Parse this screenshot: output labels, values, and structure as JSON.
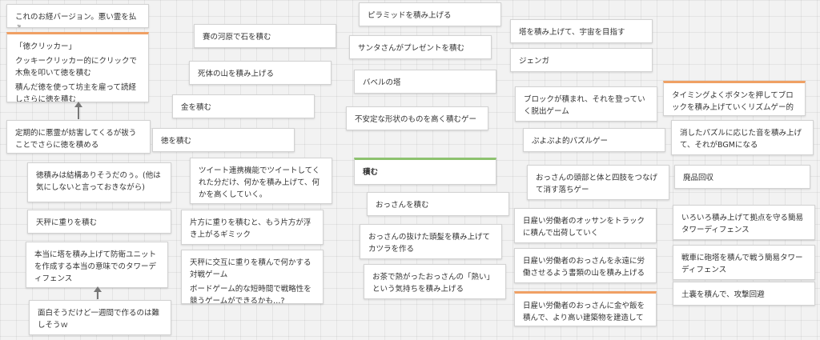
{
  "cards": {
    "c1": "これのお経バージョン。悪い霊を払う。",
    "c2_title": "「徳クリッカー」",
    "c2_line1": "クッキークリッカー的にクリックで木魚を叩いて徳を積む",
    "c2_line2": "積んだ徳を使って坊主を雇って読経しさらに徳を積む",
    "c3": "定期的に悪霊が妨害してくるが祓うことでさらに徳を積める",
    "c4": "徳積みは結構ありそうだのぅ。(他は気にしないと言っておきながら)",
    "c5": "天秤に重りを積む",
    "c6": "本当に塔を積み上げて防衛ユニットを作成する本当の意味でのタワーディフェンス",
    "c7": "面白そうだけど一週間で作るのは難しそうｗ",
    "c8": "賽の河原で石を積む",
    "c9": "死体の山を積み上げる",
    "c10": "金を積む",
    "c11": "徳を積む",
    "c12": "ツイート連携機能でツイートしてくれた分だけ、何かを積み上げて、何かを高くしていく。",
    "c13": "片方に重りを積むと、もう片方が浮き上がるギミック",
    "c14_line1": "天秤に交互に重りを積んで何かする対戦ゲーム",
    "c14_line2": "ボードゲーム的な短時間で戦略性を競うゲームができるかも…?",
    "c15": "ピラミッドを積み上げる",
    "c16": "サンタさんがプレゼントを積む",
    "c17": "バベルの塔",
    "c18": "不安定な形状のものを高く積むゲー",
    "c19": "積む",
    "c20": "おっさんを積む",
    "c21": "おっさんの抜けた頭髪を積み上げてカツラを作る",
    "c22": "お茶で熱がったおっさんの「熱い」という気持ちを積み上げる",
    "c23": "塔を積み上げて、宇宙を目指す",
    "c24": "ジェンガ",
    "c25": "ブロックが積まれ、それを登っていく脱出ゲーム",
    "c26": "ぷよぷよ的パズルゲー",
    "c27": "おっさんの頭部と体と四肢をつなげて消す落ちゲー",
    "c28": "日雇い労働者のオッサンをトラックに積んで出荷していく",
    "c29": "日雇い労働者のおっさんを永遠に労働させるよう書類の山を積み上げる",
    "c30": "日雇い労働者のおっさんに金や飯を積んで、より高い建築物を建造していく。",
    "c31": "タイミングよくボタンを押してブロックを積み上げていくリズムゲー的なもの",
    "c32": "消したパズルに応じた音を積み上げて、それがBGMになる",
    "c33": "廃品回収",
    "c34": "いろいろ積み上げて拠点を守る簡易タワーディフェンス",
    "c35": "戦車に砲塔を積んで戦う簡易タワーディフェンス",
    "c36": "土嚢を積んで、攻撃回避"
  },
  "colors": {
    "orange_accent": "#f0a064",
    "green_accent": "#8dc26f",
    "background": "#f2f2f2"
  }
}
